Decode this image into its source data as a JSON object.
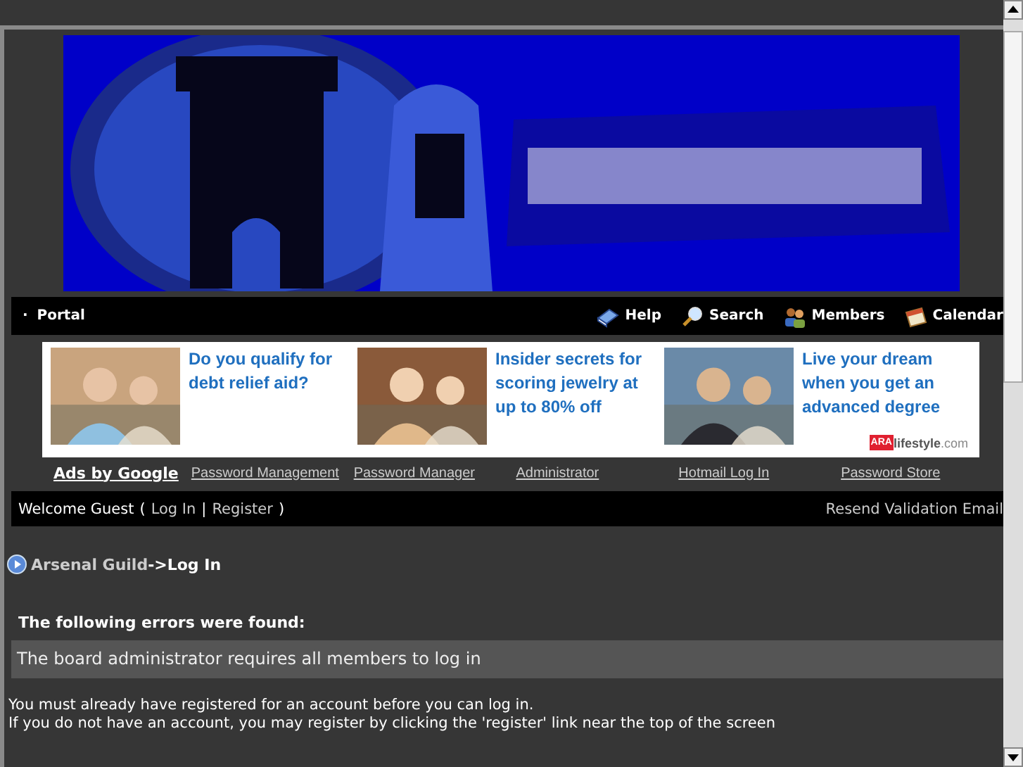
{
  "nav": {
    "left": {
      "bullet": "·",
      "label": "Portal"
    },
    "items": [
      {
        "label": "Help"
      },
      {
        "label": "Search"
      },
      {
        "label": "Members"
      },
      {
        "label": "Calendar"
      }
    ]
  },
  "ads": [
    {
      "text": "Do you qualify for debt relief aid?"
    },
    {
      "text": "Insider secrets for scoring jewelry at up to 80% off"
    },
    {
      "text": "Live your dream when you get an advanced degree"
    }
  ],
  "ad_brand": {
    "mark": "ARA",
    "name": "lifestyle",
    "suffix": ".com"
  },
  "ad_links": {
    "label": "Ads by Google",
    "links": [
      "Password Management",
      "Password Manager",
      "Administrator",
      "Hotmail Log In",
      "Password Store"
    ]
  },
  "welcome": {
    "greeting": "Welcome Guest",
    "open": "(",
    "login": "Log In",
    "sep": "|",
    "register": "Register",
    "close": ")",
    "resend": "Resend Validation Email"
  },
  "breadcrumb": {
    "parent": "Arsenal Guild",
    "arrow": "->",
    "current": "Log In"
  },
  "errors": {
    "title": "The following errors were found:",
    "message": "The board administrator requires all members to log in"
  },
  "info": [
    "You must already have registered for an account before you can log in.",
    "If you do not have an account, you may register by clicking the 'register' link near the top of the screen"
  ]
}
